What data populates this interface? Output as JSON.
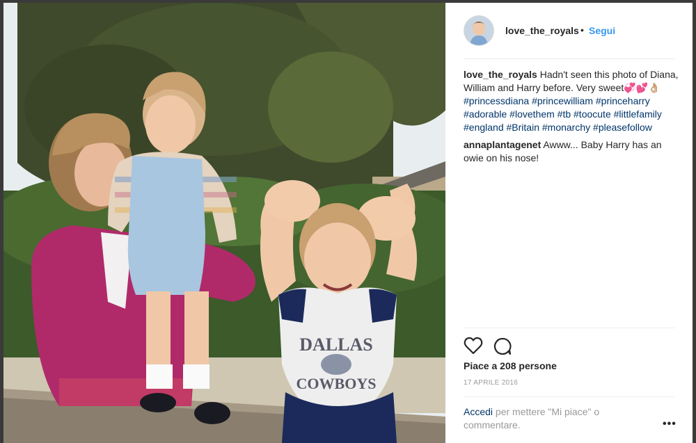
{
  "post": {
    "username": "love_the_royals",
    "separator": "•",
    "follow_label": "Segui"
  },
  "caption": {
    "username": "love_the_royals",
    "text": " Hadn't seen this photo of Diana, William and Harry before. Very sweet💞💕👌🏼 ",
    "hashtags": [
      "#princessdiana",
      "#princewilliam",
      "#princeharry",
      "#adorable",
      "#lovethem",
      "#tb",
      "#toocute",
      "#littlefamily",
      "#england",
      "#Britain",
      "#monarchy",
      "#pleasefollow"
    ]
  },
  "comments": [
    {
      "username": "annaplantagenet",
      "text": " Awww... Baby Harry has an owie on his nose!"
    }
  ],
  "actions": {
    "like_icon": "heart-outline-icon",
    "comment_icon": "comment-bubble-icon"
  },
  "likes": "Piace a 208 persone",
  "date": "17 APRILE 2016",
  "login": {
    "link": "Accedi",
    "text": " per mettere \"Mi piace\" o commentare."
  },
  "more_label": "•••",
  "photo": {
    "shirt_text_top": "DALLAS",
    "shirt_text_bottom": "COWBOYS"
  },
  "colors": {
    "accent": "#3897f0",
    "hashtag": "#003569",
    "muted": "#999999",
    "text": "#262626"
  }
}
